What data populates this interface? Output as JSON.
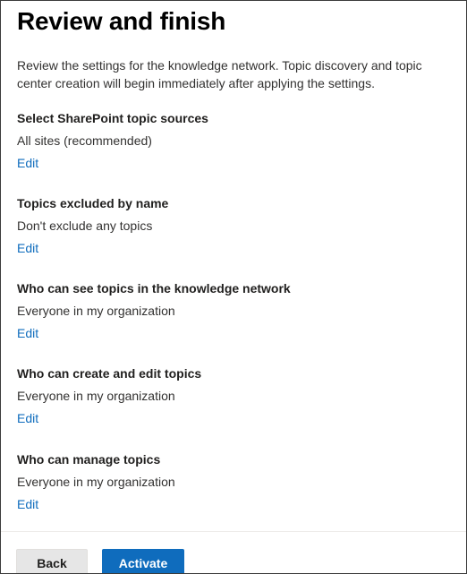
{
  "page": {
    "title": "Review and finish",
    "intro": "Review the settings for the knowledge network. Topic discovery and topic center creation will begin immediately after applying the settings."
  },
  "sections": [
    {
      "heading": "Select SharePoint topic sources",
      "value": "All sites (recommended)",
      "edit_label": "Edit"
    },
    {
      "heading": "Topics excluded by name",
      "value": "Don't exclude any topics",
      "edit_label": "Edit"
    },
    {
      "heading": "Who can see topics in the knowledge network",
      "value": "Everyone in my organization",
      "edit_label": "Edit"
    },
    {
      "heading": "Who can create and edit topics",
      "value": "Everyone in my organization",
      "edit_label": "Edit"
    },
    {
      "heading": "Who can manage topics",
      "value": "Everyone in my organization",
      "edit_label": "Edit"
    }
  ],
  "footer": {
    "back_label": "Back",
    "activate_label": "Activate"
  },
  "colors": {
    "link": "#0f6cbd",
    "primary_button": "#0f6cbd",
    "secondary_button": "#e6e6e6"
  }
}
